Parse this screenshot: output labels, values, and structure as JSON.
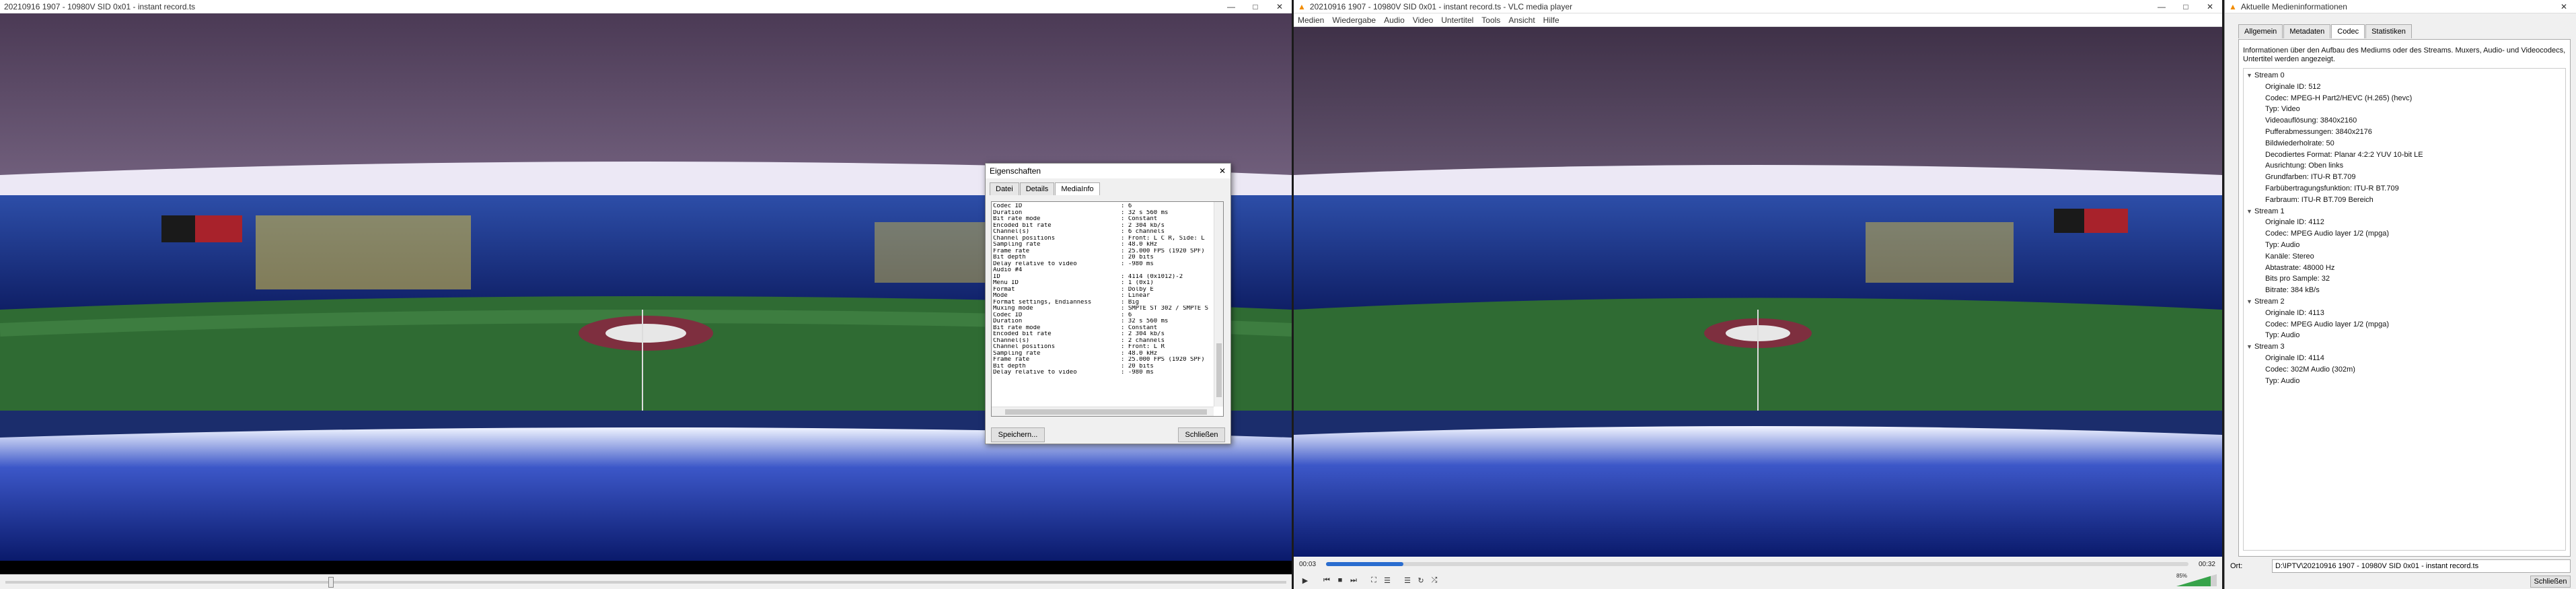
{
  "left_window": {
    "title": "20210916 1907 - 10980V SID 0x01 - instant record.ts"
  },
  "properties_dialog": {
    "title": "Eigenschaften",
    "tabs": [
      "Datei",
      "Details",
      "MediaInfo"
    ],
    "active_tab": "MediaInfo",
    "rows": [
      {
        "k": "Codec ID",
        "v": ": 6"
      },
      {
        "k": "Duration",
        "v": ": 32 s 560 ms"
      },
      {
        "k": "Bit rate mode",
        "v": ": Constant"
      },
      {
        "k": "Encoded bit rate",
        "v": ": 2 304 kb/s"
      },
      {
        "k": "Channel(s)",
        "v": ": 6 channels"
      },
      {
        "k": "Channel positions",
        "v": ": Front: L C R, Side: L"
      },
      {
        "k": "Sampling rate",
        "v": ": 48.0 kHz"
      },
      {
        "k": "Frame rate",
        "v": ": 25.000 FPS (1920 SPF)"
      },
      {
        "k": "Bit depth",
        "v": ": 20 bits"
      },
      {
        "k": "Delay relative to video",
        "v": ": -980 ms"
      },
      {
        "k": "",
        "v": ""
      },
      {
        "k": "Audio #4",
        "v": ""
      },
      {
        "k": "ID",
        "v": ": 4114 (0x1012)-2"
      },
      {
        "k": "Menu ID",
        "v": ": 1 (0x1)"
      },
      {
        "k": "Format",
        "v": ": Dolby E"
      },
      {
        "k": "Mode",
        "v": ": Linear"
      },
      {
        "k": "Format settings, Endianness",
        "v": ": Big"
      },
      {
        "k": "Muxing mode",
        "v": ": SMPTE ST 302 / SMPTE S"
      },
      {
        "k": "Codec ID",
        "v": ": 6"
      },
      {
        "k": "Duration",
        "v": ": 32 s 560 ms"
      },
      {
        "k": "Bit rate mode",
        "v": ": Constant"
      },
      {
        "k": "Encoded bit rate",
        "v": ": 2 304 kb/s"
      },
      {
        "k": "Channel(s)",
        "v": ": 2 channels"
      },
      {
        "k": "Channel positions",
        "v": ": Front: L R"
      },
      {
        "k": "Sampling rate",
        "v": ": 48.0 kHz"
      },
      {
        "k": "Frame rate",
        "v": ": 25.000 FPS (1920 SPF)"
      },
      {
        "k": "Bit depth",
        "v": ": 20 bits"
      },
      {
        "k": "Delay relative to video",
        "v": ": -980 ms"
      }
    ],
    "save_label": "Speichern...",
    "close_label": "Schließen"
  },
  "vlc": {
    "title": "20210916 1907 - 10980V SID 0x01 - instant record.ts - VLC media player",
    "menu": [
      "Medien",
      "Wiedergabe",
      "Audio",
      "Video",
      "Untertitel",
      "Tools",
      "Ansicht",
      "Hilfe"
    ],
    "time_elapsed": "00:03",
    "time_total": "00:32",
    "progress_fraction": 0.09,
    "volume_label": "85%"
  },
  "media_info": {
    "title": "Aktuelle Medieninformationen",
    "tabs": [
      "Allgemein",
      "Metadaten",
      "Codec",
      "Statistiken"
    ],
    "active_tab": "Codec",
    "description": "Informationen über den Aufbau des Mediums oder des Streams. Muxers, Audio- und Videocodecs, Untertitel werden angezeigt.",
    "streams": [
      {
        "name": "Stream 0",
        "items": [
          "Originale ID: 512",
          "Codec: MPEG-H Part2/HEVC (H.265) (hevc)",
          "Typ: Video",
          "Videoauflösung: 3840x2160",
          "Pufferabmessungen: 3840x2176",
          "Bildwiederholrate: 50",
          "Decodiertes Format: Planar 4:2:2 YUV 10-bit LE",
          "Ausrichtung: Oben links",
          "Grundfarben: ITU-R BT.709",
          "Farbübertragungsfunktion: ITU-R BT.709",
          "Farbraum: ITU-R BT.709 Bereich"
        ]
      },
      {
        "name": "Stream 1",
        "items": [
          "Originale ID: 4112",
          "Codec: MPEG Audio layer 1/2 (mpga)",
          "Typ: Audio",
          "Kanäle: Stereo",
          "Abtastrate: 48000 Hz",
          "Bits pro Sample: 32",
          "Bitrate: 384 kB/s"
        ]
      },
      {
        "name": "Stream 2",
        "items": [
          "Originale ID: 4113",
          "Codec: MPEG Audio layer 1/2 (mpga)",
          "Typ: Audio"
        ]
      },
      {
        "name": "Stream 3",
        "items": [
          "Originale ID: 4114",
          "Codec: 302M Audio (302m)",
          "Typ: Audio"
        ]
      }
    ],
    "location_label": "Ort:",
    "location_value": "D:\\IPTV\\20210916 1907 - 10980V SID 0x01 - instant record.ts",
    "close_label": "Schließen"
  }
}
